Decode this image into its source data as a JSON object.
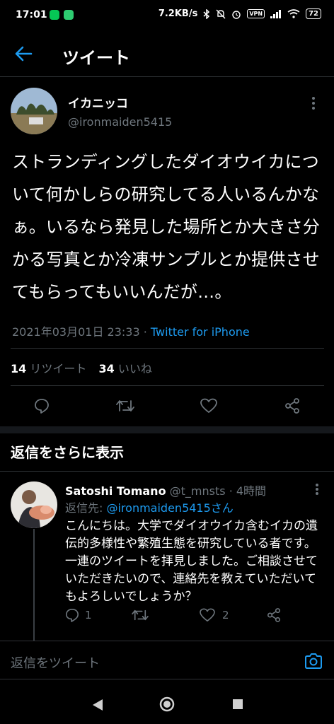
{
  "status_bar": {
    "time": "17:01",
    "network_speed": "7.2KB/s",
    "vpn": "VPN",
    "battery": "72"
  },
  "header": {
    "title": "ツイート"
  },
  "tweet": {
    "author_name": "イカニッコ",
    "author_handle": "@ironmaiden5415",
    "text": "ストランディングしたダイオウイカについて何かしらの研究してる人いるんかなぁ。いるなら発見した場所とか大きさ分かる写真とか冷凍サンプルとか提供させてもらってもいいんだが…。",
    "timestamp": "2021年03月01日 23:33",
    "separator": " · ",
    "source": "Twitter for iPhone",
    "retweet_count": "14",
    "retweet_label": "リツイート",
    "like_count": "34",
    "like_label": "いいね"
  },
  "more_replies": "返信をさらに表示",
  "reply": {
    "name": "Satoshi Tomano",
    "handle": "@t_mnsts",
    "time": "· 4時間",
    "reply_to_label": "返信先: ",
    "reply_to_handle": "@ironmaiden5415さん",
    "text": "こんにちは。大学でダイオウイカ含むイカの遺伝的多様性や繁殖生態を研究している者です。一連のツイートを拝見しました。ご相談させていただきたいので、連絡先を教えていただいてもよろしいでしょうか？",
    "reply_count": "1",
    "like_count": "2"
  },
  "compose": {
    "placeholder": "返信をツイート"
  },
  "colors": {
    "background": "#000000",
    "accent": "#1d9bf0",
    "muted": "#6e767d",
    "divider": "#2f3336"
  }
}
